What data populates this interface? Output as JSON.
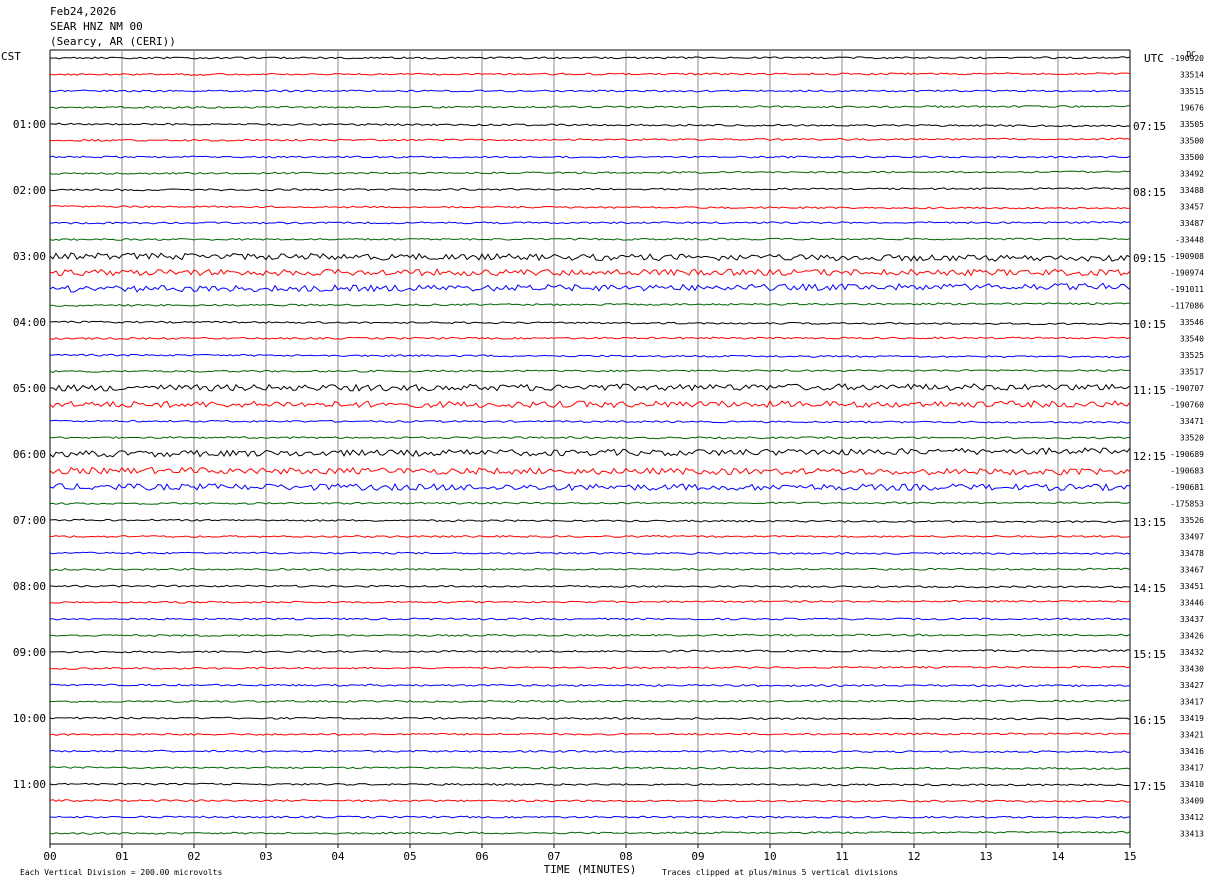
{
  "header": {
    "date": "Feb24,2026",
    "station": "SEAR HNZ NM 00",
    "location": "(Searcy, AR (CERI))"
  },
  "chart_data": {
    "type": "line",
    "title": "",
    "left_tz": "CST",
    "right_tz": "UTC",
    "dc_label": "DC",
    "xlabel": "TIME (MINUTES)",
    "x_ticks": [
      "00",
      "01",
      "02",
      "03",
      "04",
      "05",
      "06",
      "07",
      "08",
      "09",
      "10",
      "11",
      "12",
      "13",
      "14",
      "15"
    ],
    "xlim": [
      0,
      15
    ],
    "left_hours": [
      "01:00",
      "02:00",
      "03:00",
      "04:00",
      "05:00",
      "06:00",
      "07:00",
      "08:00",
      "09:00",
      "10:00",
      "11:00"
    ],
    "right_hours": [
      "07:15",
      "08:15",
      "09:15",
      "10:15",
      "11:15",
      "12:15",
      "13:15",
      "14:15",
      "15:15",
      "16:15",
      "17:15"
    ],
    "dc_values": [
      "-190920",
      "33514",
      "33515",
      "19676",
      "33505",
      "33500",
      "33500",
      "33492",
      "33488",
      "33457",
      "33487",
      "-33448",
      "-190908",
      "-190974",
      "-191011",
      "-117086",
      "33546",
      "33540",
      "33525",
      "33517",
      "-190707",
      "-190760",
      "33471",
      "33520",
      "-190689",
      "-190683",
      "-190681",
      "-175853",
      "33526",
      "33497",
      "33478",
      "33467",
      "33451",
      "33446",
      "33437",
      "33426",
      "33432",
      "33430",
      "33427",
      "33417",
      "33419",
      "33421",
      "33416",
      "33417",
      "33410",
      "33409",
      "33412",
      "33413"
    ],
    "trace_colors": [
      "#000000",
      "#ff0000",
      "#0000ff",
      "#006400"
    ],
    "footer_left": "Each Vertical Division =  200.00 microvolts",
    "footer_right": "Traces clipped at plus/minus 5 vertical divisions"
  }
}
